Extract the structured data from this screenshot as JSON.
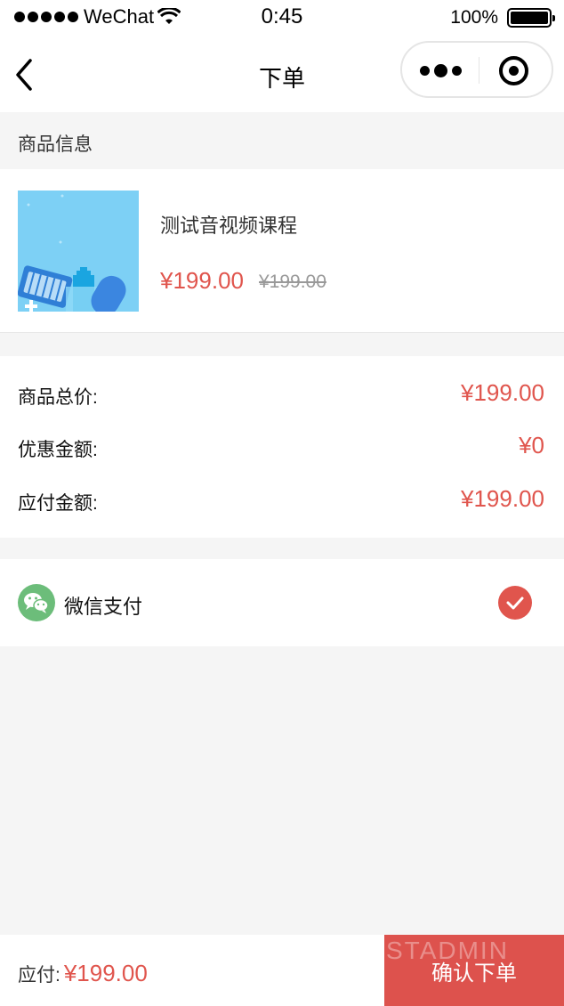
{
  "status_bar": {
    "carrier": "WeChat",
    "time": "0:45",
    "battery": "100%"
  },
  "nav": {
    "title": "下单"
  },
  "product_section": {
    "heading": "商品信息",
    "product": {
      "name": "测试音视频课程",
      "price": "¥199.00",
      "original_price": "¥199.00"
    }
  },
  "totals": [
    {
      "label": "商品总价:",
      "value": "¥199.00"
    },
    {
      "label": "优惠金额:",
      "value": "¥0"
    },
    {
      "label": "应付金额:",
      "value": "¥199.00"
    }
  ],
  "payment": {
    "method": "微信支付",
    "selected": true
  },
  "bottom": {
    "pay_label": "应付:",
    "pay_amount": "¥199.00",
    "confirm_label": "确认下单",
    "watermark": "STADMIN"
  },
  "colors": {
    "accent": "#e0554d",
    "button": "#dd524d",
    "wechat_green": "#6cbd7a"
  }
}
